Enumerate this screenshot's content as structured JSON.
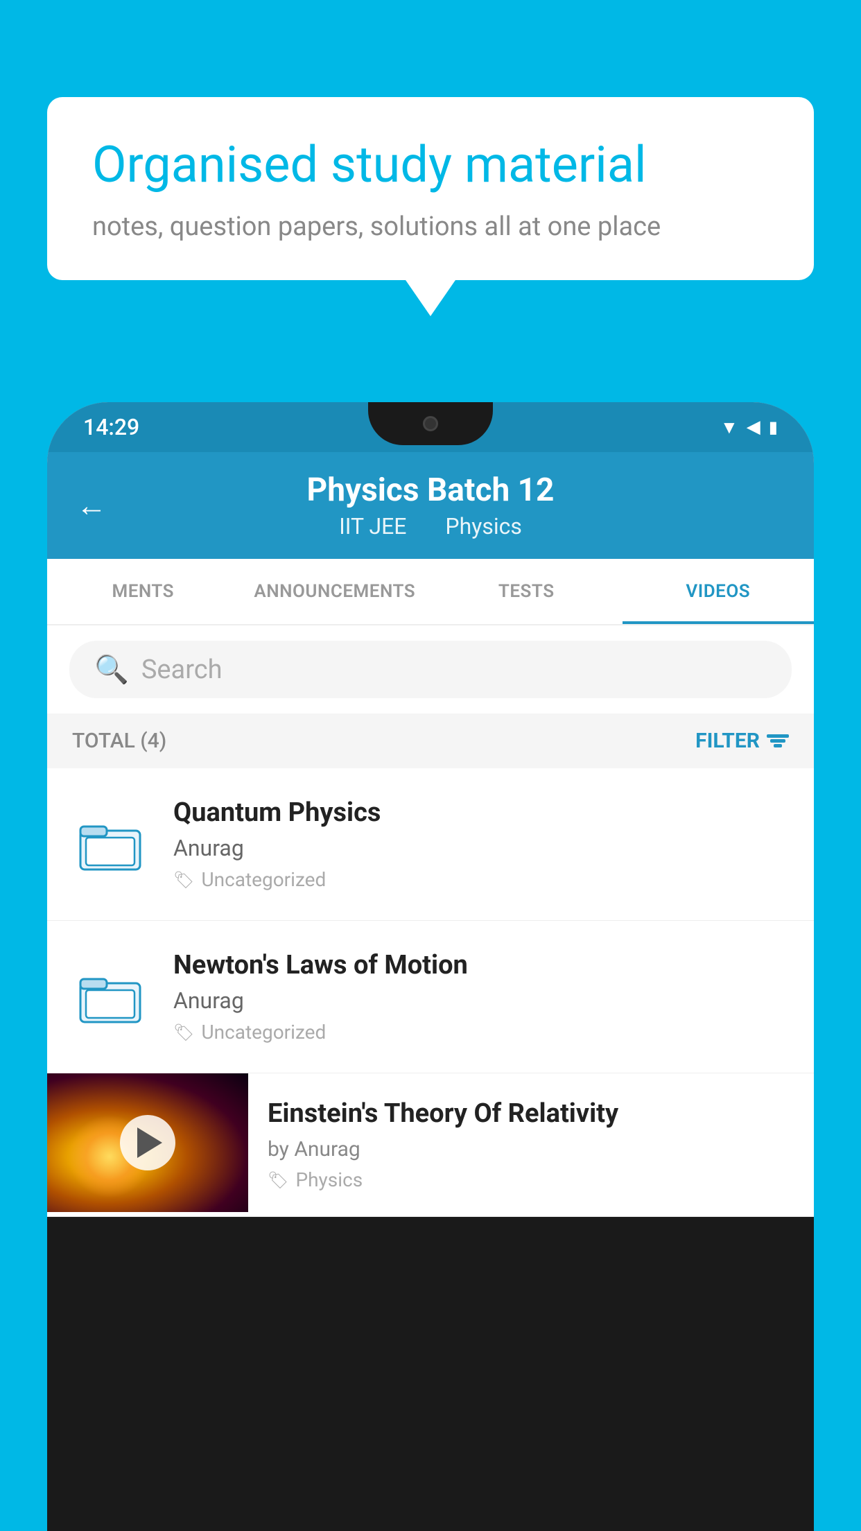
{
  "background_color": "#00b8e6",
  "speech_bubble": {
    "title": "Organised study material",
    "subtitle": "notes, question papers, solutions all at one place"
  },
  "status_bar": {
    "time": "14:29"
  },
  "app_header": {
    "title": "Physics Batch 12",
    "subtitle_part1": "IIT JEE",
    "subtitle_part2": "Physics",
    "back_label": "←"
  },
  "tabs": [
    {
      "label": "MENTS",
      "active": false
    },
    {
      "label": "ANNOUNCEMENTS",
      "active": false
    },
    {
      "label": "TESTS",
      "active": false
    },
    {
      "label": "VIDEOS",
      "active": true
    }
  ],
  "search": {
    "placeholder": "Search"
  },
  "filter": {
    "total_label": "TOTAL (4)",
    "filter_label": "FILTER"
  },
  "videos": [
    {
      "title": "Quantum Physics",
      "author": "Anurag",
      "tag": "Uncategorized",
      "has_thumbnail": false
    },
    {
      "title": "Newton's Laws of Motion",
      "author": "Anurag",
      "tag": "Uncategorized",
      "has_thumbnail": false
    },
    {
      "title": "Einstein's Theory Of Relativity",
      "author": "by Anurag",
      "tag": "Physics",
      "has_thumbnail": true
    }
  ]
}
